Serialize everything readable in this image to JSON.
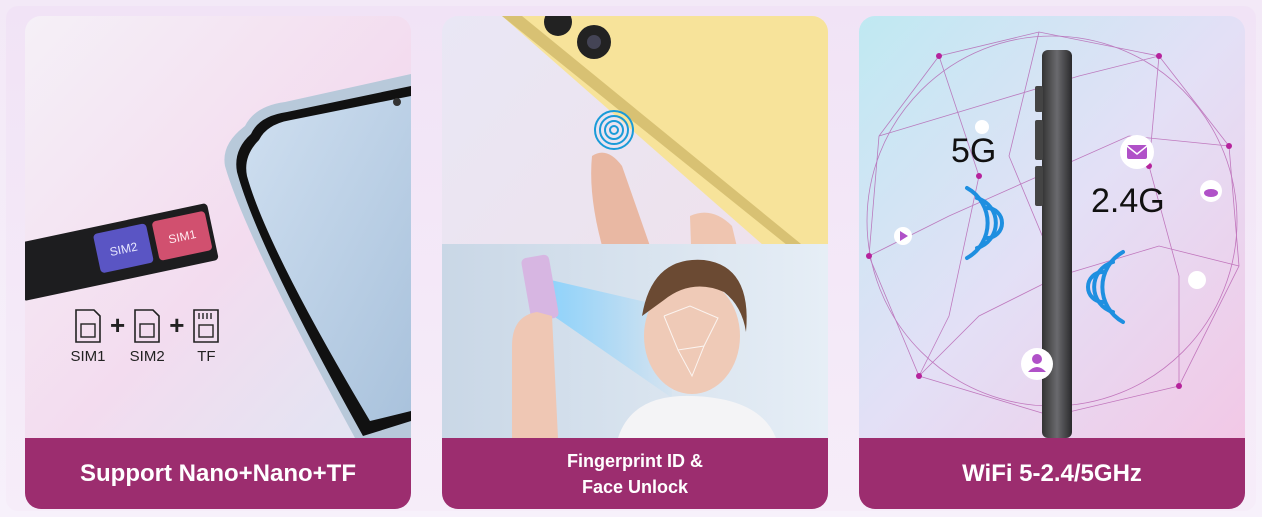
{
  "cards": [
    {
      "caption": "Support Nano+Nano+TF",
      "tray_labels": {
        "sim2": "SIM2",
        "sim1": "SIM1"
      },
      "slots": [
        {
          "label": "SIM1",
          "icon": "sim-card-icon"
        },
        {
          "label": "SIM2",
          "icon": "sim-card-icon"
        },
        {
          "label": "TF",
          "icon": "tf-card-icon"
        }
      ],
      "plus": "+"
    },
    {
      "caption_line1": "Fingerprint ID &",
      "caption_line2": "Face Unlock",
      "icons": [
        "fingerprint-icon",
        "face-scan-icon"
      ]
    },
    {
      "caption": "WiFi 5-2.4/5GHz",
      "band_5g": "5G",
      "band_24g": "2.4G",
      "icons": [
        "wifi-signal-icon",
        "mail-icon",
        "cloud-icon",
        "user-icon",
        "play-icon"
      ]
    }
  ],
  "colors": {
    "caption_bg": "#9c2d6f",
    "wifi_blue": "#1e8fe0",
    "fingerprint_blue": "#1a9bd8"
  }
}
